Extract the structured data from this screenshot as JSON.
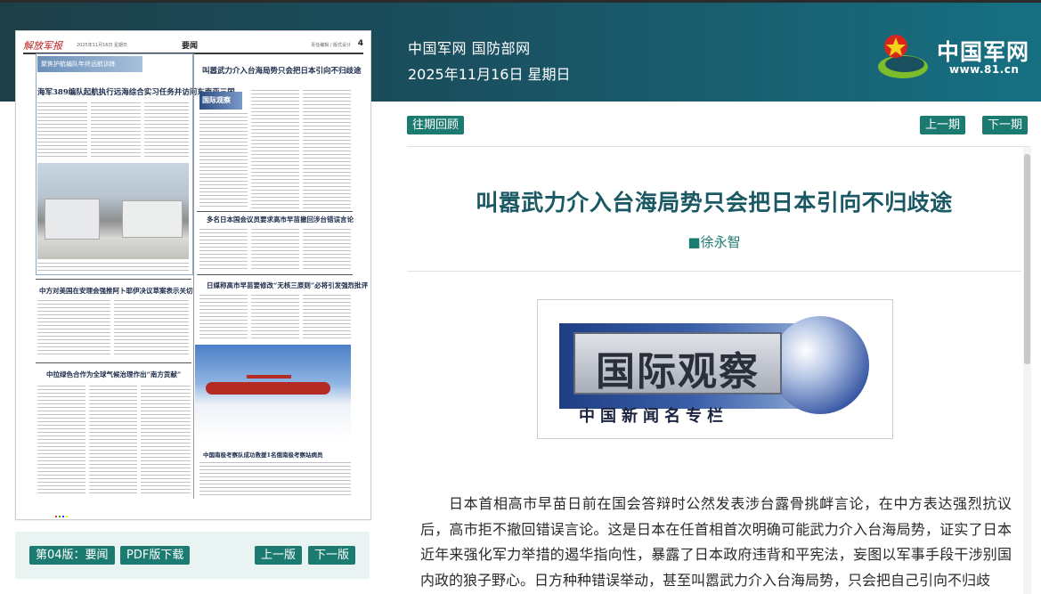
{
  "header": {
    "site_name": "中国军网 国防部网",
    "date": "2025年11月16日 星期日",
    "logo_text": "中国军网",
    "logo_url": "www.81.cn"
  },
  "paper": {
    "masthead": "解放军报",
    "masthead_date": "2025年11月16日 星期日",
    "section": "要闻",
    "editor": "责任编辑 / 版式设计",
    "page_no": "4",
    "banner": "聚焦护航编队年终远航训练",
    "headlines": [
      "海军389编队起航执行远海综合实习任务并访问东南亚三国",
      "叫嚣武力介入台海局势只会把日本引向不归歧途",
      "多名日本国会议员要求高市早苗撤回涉台错误言论",
      "日媒称高市早苗要修改“无核三原则”必将引发强烈批评",
      "中方对美国在安理会强推阿卜耶伊决议草案表示关切",
      "中拉绿色合作为全球气候治理作出“南方贡献”",
      "中国南极考察队成功救援1名俄南极考察站病员"
    ],
    "column_tag": "国际观察"
  },
  "paper_bar": {
    "edition_label": "第04版：要闻",
    "pdf_label": "PDF版下载",
    "prev_label": "上一版",
    "next_label": "下一版"
  },
  "toolbar": {
    "archive_label": "往期回顾",
    "prev_issue_label": "上一期",
    "next_issue_label": "下一期"
  },
  "article": {
    "title": "叫嚣武力介入台海局势只会把日本引向不归歧途",
    "author": "■徐永智",
    "column_image_title": "国际观察",
    "column_image_subtitle": "中国新闻名专栏",
    "paragraph": "日本首相高市早苗日前在国会答辩时公然发表涉台露骨挑衅言论，在中方表达强烈抗议后，高市拒不撤回错误言论。这是日本在任首相首次明确可能武力介入台海局势，证实了日本近年来强化军力举措的遏华指向性，暴露了日本政府违背和平宪法，妄图以军事手段干涉别国内政的狼子野心。日方种种错误举动，甚至叫嚣武力介入台海局势，只会把自己引向不归歧"
  },
  "colors": {
    "header_dark": "#1d3f48",
    "header_light": "#167082",
    "button": "#1c7b70",
    "title": "#1a5964",
    "paper_bar_bg": "#e9f3f1"
  }
}
